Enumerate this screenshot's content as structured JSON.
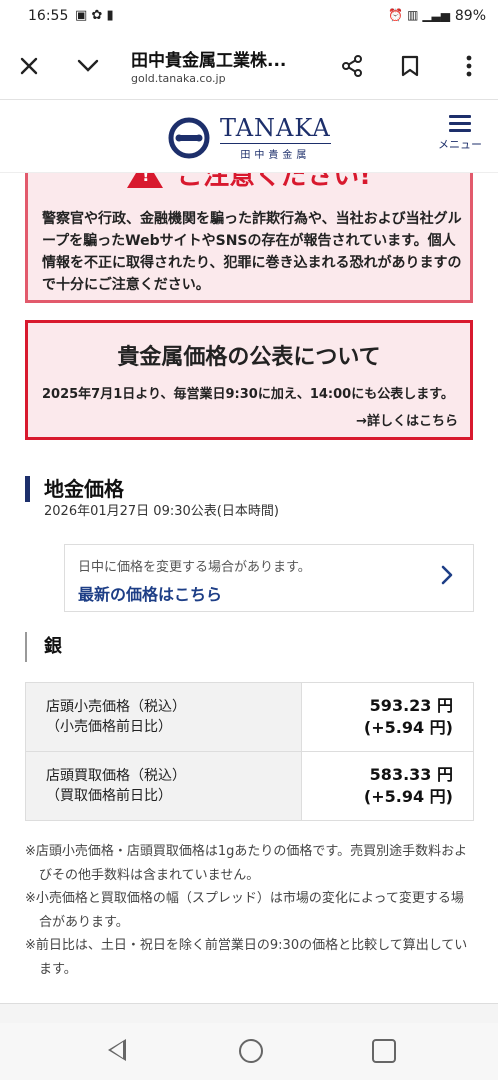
{
  "status": {
    "time": "16:55",
    "battery": "89%",
    "icons": [
      "gallery-icon",
      "bug-icon",
      "sd-card-icon",
      "alarm-icon",
      "vibrate-icon",
      "signal-icon"
    ]
  },
  "browser": {
    "title": "田中貴金属工業株...",
    "url": "gold.tanaka.co.jp",
    "close_icon": "✕",
    "chevron_icon": "⌄",
    "share_icon": "share-icon",
    "bookmark_icon": "bookmark-icon",
    "more_icon": "more-vert-icon"
  },
  "header": {
    "logo_text": "TANAKA",
    "logo_subtext": "田中貴金属",
    "menu_label": "メニュー"
  },
  "warning": {
    "heading": "ご注意ください!",
    "body": "警察官や行政、金融機関を騙った詐欺行為や、当社および当社グループを騙ったWebサイトやSNSの存在が報告されています。個人情報を不正に取得されたり、犯罪に巻き込まれる恐れがありますので十分にご注意ください。"
  },
  "notice": {
    "title": "貴金属価格の公表について",
    "text": "2025年7月1日より、毎営業日9:30に加え、14:00にも公表します。",
    "link": "→詳しくはこちら"
  },
  "section": {
    "title": "地金価格",
    "date": "2026年01月27日 09:30公表(日本時間)"
  },
  "update_card": {
    "note": "日中に価格を変更する場合があります。",
    "link": "最新の価格はこちら"
  },
  "metal": {
    "name": "銀"
  },
  "prices": [
    {
      "label_line1": "店頭小売価格（税込）",
      "label_line2": "（小売価格前日比）",
      "value": "593.23 円",
      "change": "(+5.94 円)"
    },
    {
      "label_line1": "店頭買取価格（税込）",
      "label_line2": "（買取価格前日比）",
      "value": "583.33 円",
      "change": "(+5.94 円)"
    }
  ],
  "notes": [
    "※店頭小売価格・店頭買取価格は1gあたりの価格です。売買別途手数料およびその他手数料は含まれていません。",
    "※小売価格と買取価格の幅（スプレッド）は市場の変化によって変更する場合があります。",
    "※前日比は、土日・祝日を除く前営業日の9:30の価格と比較して算出しています。"
  ]
}
